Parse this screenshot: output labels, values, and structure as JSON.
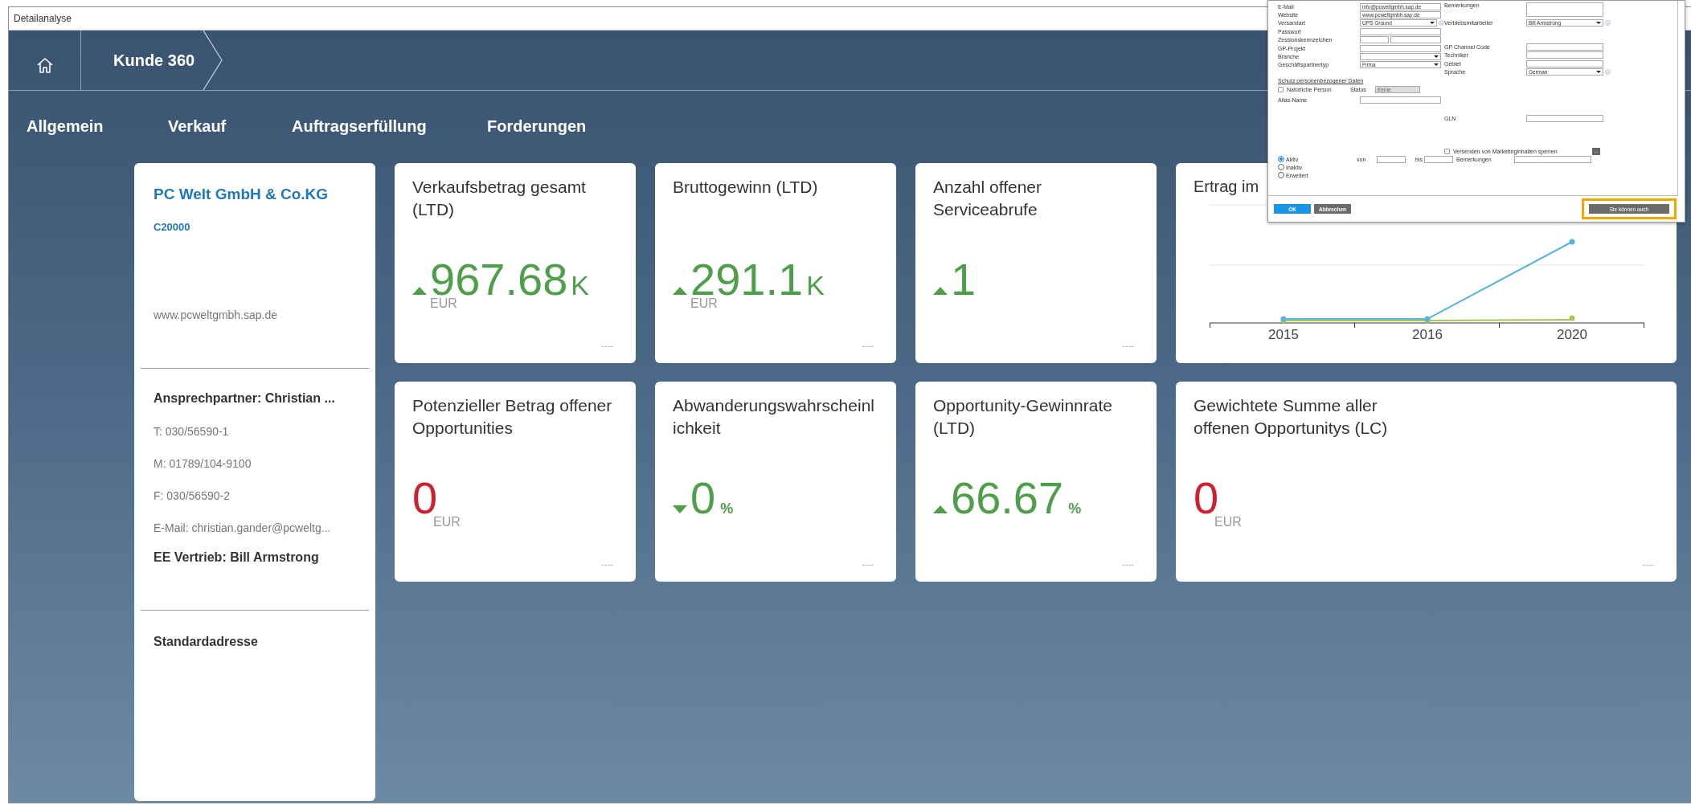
{
  "window": {
    "title": "Detailanalyse"
  },
  "breadcrumb": {
    "current": "Kunde 360"
  },
  "tabs": [
    {
      "label": "Allgemein"
    },
    {
      "label": "Verkauf"
    },
    {
      "label": "Auftragserfüllung"
    },
    {
      "label": "Forderungen"
    }
  ],
  "account": {
    "name": "PC Welt GmbH & Co.KG",
    "id": "C20000",
    "website": "www.pcweltgmbh.sap.de",
    "contact_heading": "Ansprechpartner: Christian ...",
    "contact_lines": [
      "T: 030/56590-1",
      "M: 01789/104-9100",
      "F: 030/56590-2",
      "E-Mail: christian.gander@pcweltg..."
    ],
    "sales_rep": "EE Vertrieb: Bill Armstrong",
    "address_heading": "Standardadresse"
  },
  "kpis": [
    {
      "title": "Verkaufsbetrag gesamt (LTD)",
      "value": "967.68",
      "suffix": "K",
      "currency": "EUR",
      "kind": "rising",
      "color": "#4f9f4a",
      "footer": "----"
    },
    {
      "title": "Bruttogewinn (LTD)",
      "value": "291.1",
      "suffix": "K",
      "currency": "EUR",
      "kind": "rising",
      "color": "#4f9f4a",
      "footer": "----"
    },
    {
      "title": "Anzahl offener Serviceabrufe",
      "value": "1",
      "kind": "rising",
      "color": "#4f9f4a",
      "footer": "----"
    },
    {
      "title": "Potenzieller Betrag offener Opportunities",
      "value": "0",
      "currency": "EUR",
      "kind": "plain",
      "color": "#d0202e",
      "footer": "----"
    },
    {
      "title": "Abwanderungswahrscheinlichkeit",
      "value": "0",
      "suffix": "%",
      "kind": "falling",
      "color": "#4f9f4a",
      "footer": "----"
    },
    {
      "title": "Opportunity-Gewinnrate (LTD)",
      "value": "66.67",
      "suffix": "%",
      "kind": "rising",
      "color": "#4f9f4a",
      "footer": "----"
    },
    {
      "title": "Gewichtete Summe aller offenen Opportunitys (LC)",
      "value": "0",
      "currency": "EUR",
      "kind": "plain",
      "color": "#d0202e",
      "footer": "----"
    }
  ],
  "revenue_chart": {
    "title": "Ertrag im",
    "x_labels": [
      "2015",
      "2016",
      "2020"
    ]
  },
  "dialog": {
    "left_fields": [
      {
        "label": "E-Mail",
        "kind": "text",
        "value": "info@pcweltgmbh.sap.de"
      },
      {
        "label": "Website",
        "kind": "text",
        "value": "www.pcweltgmbh.sap.de"
      },
      {
        "label": "Versandart",
        "kind": "select",
        "value": "UPS Ground",
        "info": true
      },
      {
        "label": "Passwort",
        "kind": "text"
      },
      {
        "label": "Zessionskennzeichen",
        "kind": "split"
      },
      {
        "label": "GP-Projekt",
        "kind": "text"
      },
      {
        "label": "Branche",
        "kind": "select"
      },
      {
        "label": "Geschäftspartnertyp",
        "kind": "select",
        "value": "Firma"
      }
    ],
    "right_groups": [
      [
        {
          "label": "Bemerkungen",
          "kind": "textarea"
        },
        {
          "label": "Vertriebsmitarbeiter",
          "kind": "select",
          "value": "Bill Armstrong",
          "info": true
        }
      ],
      [
        {
          "label": "GP Channel Code",
          "kind": "text"
        },
        {
          "label": "Techniker",
          "kind": "text"
        },
        {
          "label": "Gebiet",
          "kind": "text"
        },
        {
          "label": "Sprache",
          "kind": "select",
          "value": "German",
          "info": true
        }
      ],
      [
        {
          "label": "GLN",
          "kind": "text"
        }
      ]
    ],
    "privacy": {
      "heading": "Schutz personenbezogener Daten",
      "checkbox": {
        "label": "Natürliche Person",
        "checked": false
      },
      "status_label": "Status",
      "status_value": "Keine",
      "alias_label": "Alias-Name"
    },
    "marketing": {
      "label": "Versenden von Marketinginhalten sperren",
      "checked": false,
      "more": "..."
    },
    "status_options": [
      {
        "label": "Aktiv",
        "selected": true
      },
      {
        "label": "Inaktiv",
        "selected": false
      },
      {
        "label": "Erweitert",
        "selected": false
      }
    ],
    "validity": {
      "from_label": "von",
      "to_label": "bis",
      "remarks_label": "Bemerkungen"
    },
    "buttons": [
      {
        "label": "OK",
        "kind": "primary"
      },
      {
        "label": "Abbrechen",
        "kind": "secondary"
      }
    ],
    "extra_button": {
      "label": "Sie können auch",
      "highlighted": true
    }
  }
}
